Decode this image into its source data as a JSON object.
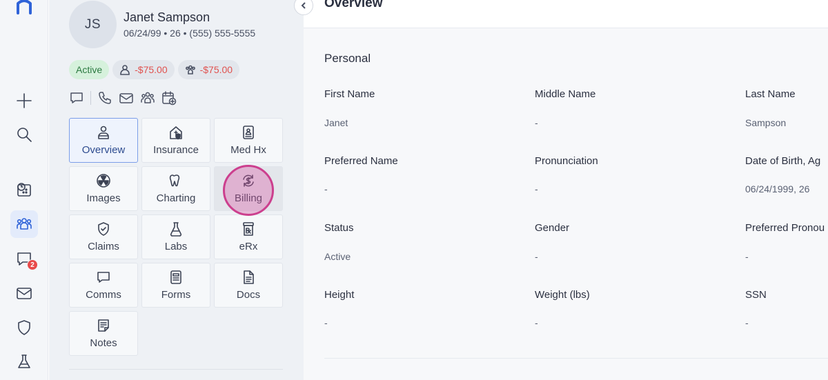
{
  "patient": {
    "initials": "JS",
    "name": "Janet Sampson",
    "info": "06/24/99 • 26 • (555) 555-5555",
    "status": "Active",
    "balance_patient": "-$75.00",
    "balance_family": "-$75.00"
  },
  "rail": {
    "icons": [
      "logo-icon",
      "add-icon",
      "search-icon",
      "schedule-icon",
      "patients-icon",
      "chat-icon",
      "mail-icon",
      "shield-icon",
      "lab-flask-icon"
    ],
    "chat_badge": "2"
  },
  "nav_tiles": [
    {
      "label": "Overview",
      "icon": "person-icon"
    },
    {
      "label": "Insurance",
      "icon": "house-shield-icon"
    },
    {
      "label": "Med Hx",
      "icon": "clipboard-person-icon"
    },
    {
      "label": "Images",
      "icon": "radiation-icon"
    },
    {
      "label": "Charting",
      "icon": "tooth-icon"
    },
    {
      "label": "Billing",
      "icon": "dollar-cycle-icon"
    },
    {
      "label": "Claims",
      "icon": "shield-check-icon"
    },
    {
      "label": "Labs",
      "icon": "flask-icon"
    },
    {
      "label": "eRx",
      "icon": "rx-bottle-icon"
    },
    {
      "label": "Comms",
      "icon": "message-icon"
    },
    {
      "label": "Forms",
      "icon": "form-icon"
    },
    {
      "label": "Docs",
      "icon": "document-icon"
    },
    {
      "label": "Notes",
      "icon": "note-icon"
    }
  ],
  "main": {
    "title": "Overview",
    "section": "Personal",
    "fields": [
      {
        "label": "First Name",
        "value": "Janet"
      },
      {
        "label": "Middle Name",
        "value": "-"
      },
      {
        "label": "Last Name",
        "value": "Sampson"
      },
      {
        "label": "Preferred Name",
        "value": "-"
      },
      {
        "label": "Pronunciation",
        "value": "-"
      },
      {
        "label": "Date of Birth, Ag",
        "value": "06/24/1999, 26"
      },
      {
        "label": "Status",
        "value": "Active"
      },
      {
        "label": "Gender",
        "value": "-"
      },
      {
        "label": "Preferred Pronou",
        "value": "-"
      },
      {
        "label": "Height",
        "value": "-"
      },
      {
        "label": "Weight (lbs)",
        "value": "-"
      },
      {
        "label": "SSN",
        "value": "-"
      }
    ]
  },
  "colors": {
    "accent": "#2f63d8",
    "status_green": "#2c7a41",
    "balance_red": "#e0524f",
    "cursor_pink": "#cc3f8e"
  }
}
